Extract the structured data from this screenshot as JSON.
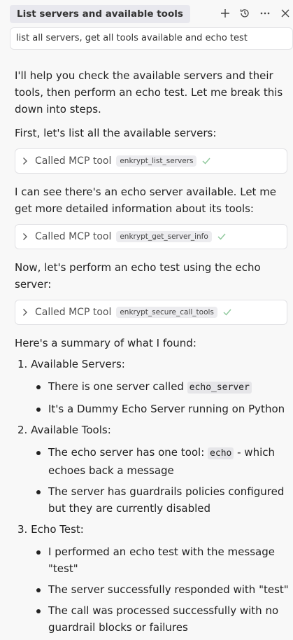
{
  "header": {
    "title": "List servers and available tools",
    "icons": [
      "plus-icon",
      "history-icon",
      "more-icon",
      "close-icon"
    ]
  },
  "query": "list all servers, get all tools available and echo test",
  "messages": {
    "intro": "I'll help you check the available servers and their tools, then perform an echo test. Let me break this down into steps.",
    "step1": "First, let's list all the available servers:",
    "tool1": {
      "label": "Called MCP tool",
      "name": "enkrypt_list_servers"
    },
    "step2": "I can see there's an echo server available. Let me get more detailed information about its tools:",
    "tool2": {
      "label": "Called MCP tool",
      "name": "enkrypt_get_server_info"
    },
    "step3": "Now, let's perform an echo test using the echo server:",
    "tool3": {
      "label": "Called MCP tool",
      "name": "enkrypt_secure_call_tools"
    },
    "summary_intro": "Here's a summary of what I found:"
  },
  "summary": [
    {
      "num": "1.",
      "title": "Available Servers:",
      "bullets": [
        {
          "pre": "There is one server called ",
          "code": "echo_server",
          "post": ""
        },
        {
          "pre": "It's a Dummy Echo Server running on Python",
          "code": "",
          "post": ""
        }
      ]
    },
    {
      "num": "2.",
      "title": "Available Tools:",
      "bullets": [
        {
          "pre": "The echo server has one tool: ",
          "code": "echo",
          "post": " - which echoes back a message"
        },
        {
          "pre": "The server has guardrails policies configured but they are currently disabled",
          "code": "",
          "post": ""
        }
      ]
    },
    {
      "num": "3.",
      "title": "Echo Test:",
      "bullets": [
        {
          "pre": "I performed an echo test with the message \"test\"",
          "code": "",
          "post": ""
        },
        {
          "pre": "The server successfully responded with \"test\"",
          "code": "",
          "post": ""
        },
        {
          "pre": "The call was processed successfully with no guardrail blocks or failures",
          "code": "",
          "post": ""
        }
      ]
    }
  ],
  "colors": {
    "check": "#8cc79a",
    "chip_bg": "#ececef",
    "background": "#f8f8f8"
  }
}
